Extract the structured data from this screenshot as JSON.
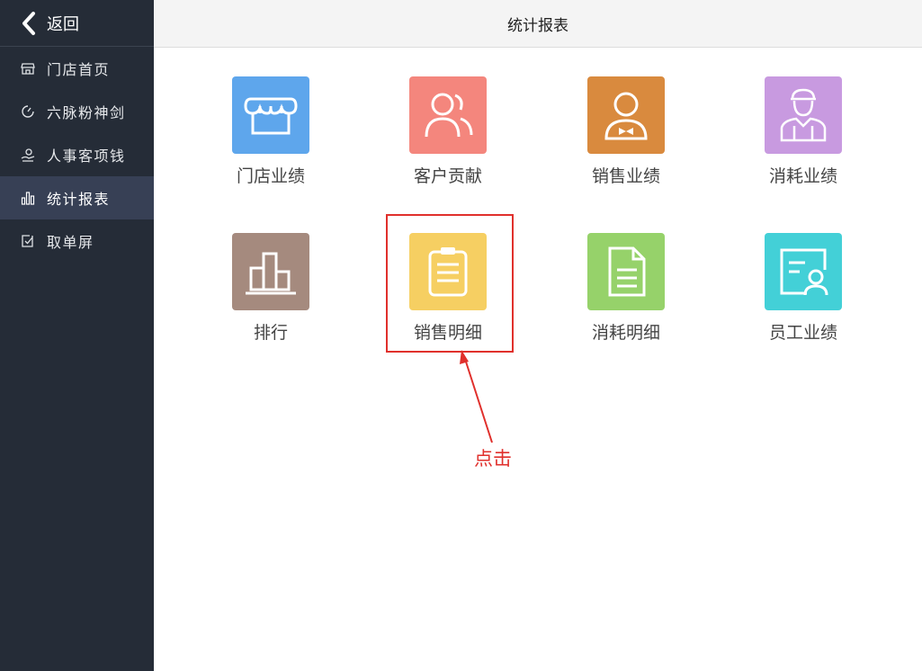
{
  "sidebar": {
    "back_label": "返回",
    "items": [
      {
        "label": "门店首页",
        "icon": "store-icon",
        "active": false
      },
      {
        "label": "六脉粉神剑",
        "icon": "gauge-icon",
        "active": false
      },
      {
        "label": "人事客项钱",
        "icon": "hand-money-icon",
        "active": false
      },
      {
        "label": "统计报表",
        "icon": "bar-chart-icon",
        "active": true
      },
      {
        "label": "取单屏",
        "icon": "checklist-icon",
        "active": false
      }
    ]
  },
  "header": {
    "title": "统计报表"
  },
  "tiles": [
    {
      "label": "门店业绩",
      "icon": "storefront-icon",
      "color": "#5ea6ec"
    },
    {
      "label": "客户贡献",
      "icon": "customers-icon",
      "color": "#f4867d"
    },
    {
      "label": "销售业绩",
      "icon": "salesperson-icon",
      "color": "#d98a3e"
    },
    {
      "label": "消耗业绩",
      "icon": "worker-icon",
      "color": "#c89ae0"
    },
    {
      "label": "排行",
      "icon": "ranking-icon",
      "color": "#a58a7e"
    },
    {
      "label": "销售明细",
      "icon": "clipboard-icon",
      "color": "#f6cf62"
    },
    {
      "label": "消耗明细",
      "icon": "document-icon",
      "color": "#96d26a"
    },
    {
      "label": "员工业绩",
      "icon": "employee-card-icon",
      "color": "#43d0d7"
    }
  ],
  "annotation": {
    "text": "点击",
    "color": "#e0302c"
  }
}
